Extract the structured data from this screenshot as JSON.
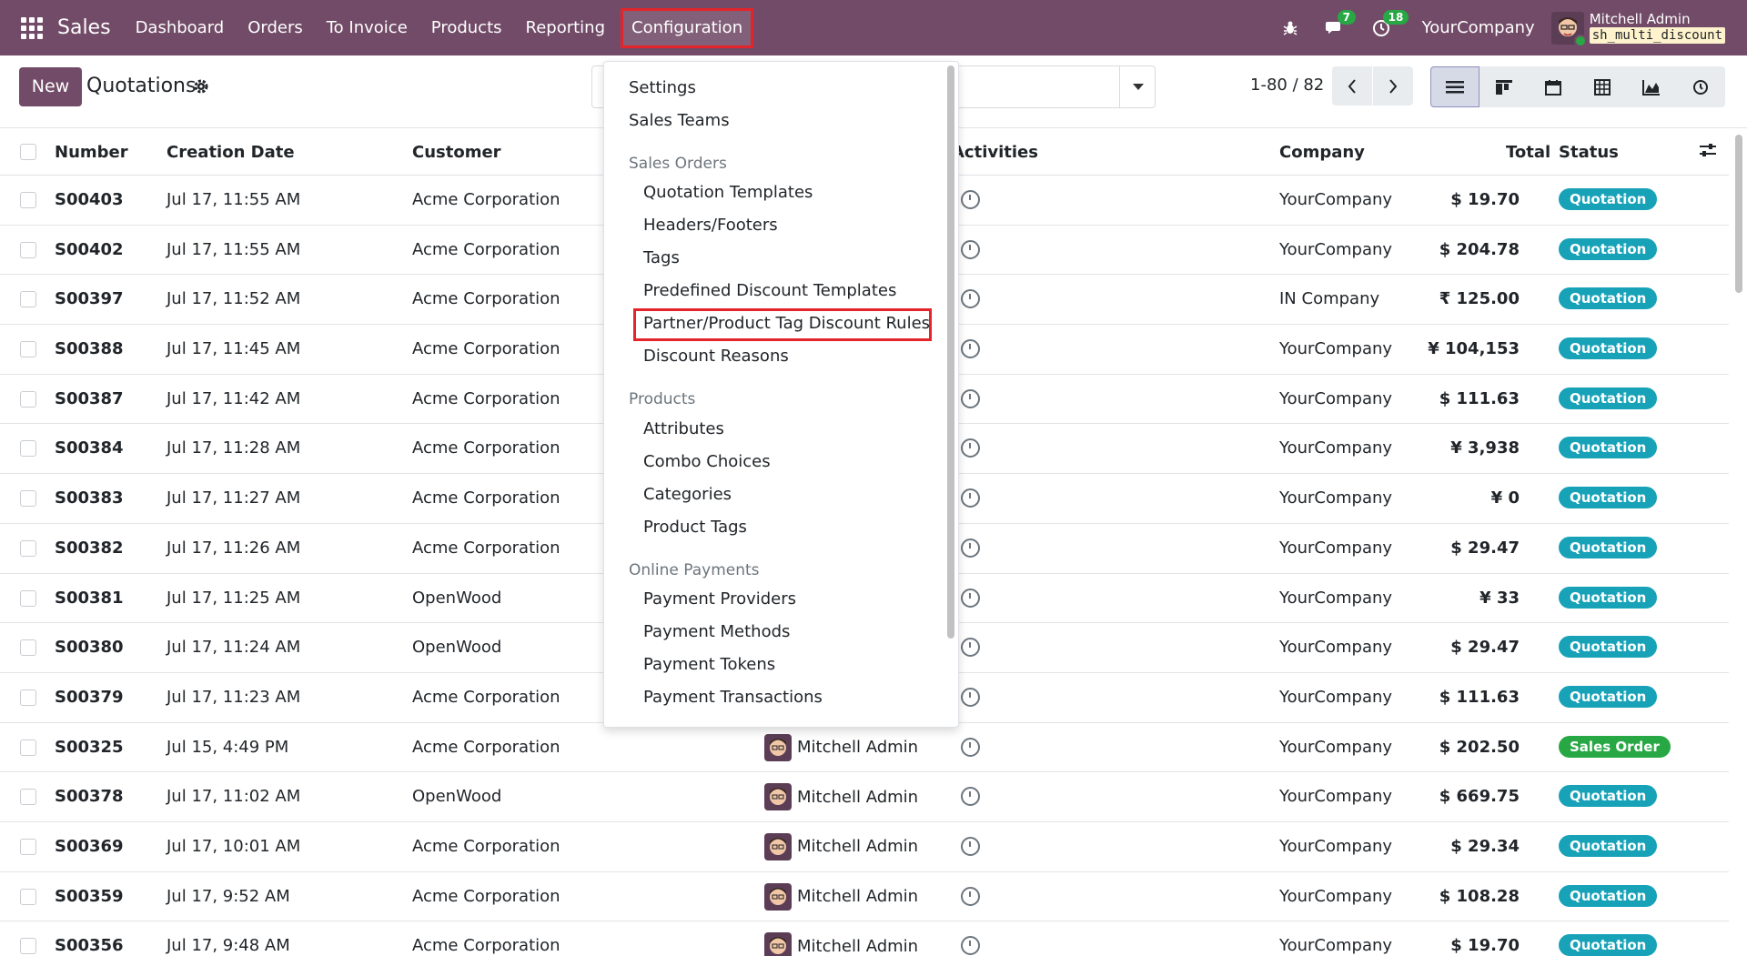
{
  "navbar": {
    "brand": "Sales",
    "menu": [
      "Dashboard",
      "Orders",
      "To Invoice",
      "Products",
      "Reporting",
      "Configuration"
    ],
    "active_menu": "Configuration",
    "messages_count": "7",
    "activities_count": "18",
    "company": "YourCompany",
    "user_name": "Mitchell Admin",
    "database": "sh_multi_discount"
  },
  "control": {
    "new_label": "New",
    "title": "Quotations",
    "pager": "1-80 / 82"
  },
  "table": {
    "headers": {
      "number": "Number",
      "creation_date": "Creation Date",
      "customer": "Customer",
      "activities": "Activities",
      "company": "Company",
      "total": "Total",
      "status": "Status"
    },
    "rows": [
      {
        "number": "S00403",
        "date": "Jul 17, 11:55 AM",
        "customer": "Acme Corporation",
        "salesperson": "",
        "company": "YourCompany",
        "total": "$ 19.70",
        "status": "Quotation"
      },
      {
        "number": "S00402",
        "date": "Jul 17, 11:55 AM",
        "customer": "Acme Corporation",
        "salesperson": "",
        "company": "YourCompany",
        "total": "$ 204.78",
        "status": "Quotation"
      },
      {
        "number": "S00397",
        "date": "Jul 17, 11:52 AM",
        "customer": "Acme Corporation",
        "salesperson": "",
        "company": "IN Company",
        "total": "₹ 125.00",
        "status": "Quotation"
      },
      {
        "number": "S00388",
        "date": "Jul 17, 11:45 AM",
        "customer": "Acme Corporation",
        "salesperson": "",
        "company": "YourCompany",
        "total": "¥ 104,153",
        "status": "Quotation"
      },
      {
        "number": "S00387",
        "date": "Jul 17, 11:42 AM",
        "customer": "Acme Corporation",
        "salesperson": "",
        "company": "YourCompany",
        "total": "$ 111.63",
        "status": "Quotation"
      },
      {
        "number": "S00384",
        "date": "Jul 17, 11:28 AM",
        "customer": "Acme Corporation",
        "salesperson": "",
        "company": "YourCompany",
        "total": "¥ 3,938",
        "status": "Quotation"
      },
      {
        "number": "S00383",
        "date": "Jul 17, 11:27 AM",
        "customer": "Acme Corporation",
        "salesperson": "",
        "company": "YourCompany",
        "total": "¥ 0",
        "status": "Quotation"
      },
      {
        "number": "S00382",
        "date": "Jul 17, 11:26 AM",
        "customer": "Acme Corporation",
        "salesperson": "",
        "company": "YourCompany",
        "total": "$ 29.47",
        "status": "Quotation"
      },
      {
        "number": "S00381",
        "date": "Jul 17, 11:25 AM",
        "customer": "OpenWood",
        "salesperson": "",
        "company": "YourCompany",
        "total": "¥ 33",
        "status": "Quotation"
      },
      {
        "number": "S00380",
        "date": "Jul 17, 11:24 AM",
        "customer": "OpenWood",
        "salesperson": "",
        "company": "YourCompany",
        "total": "$ 29.47",
        "status": "Quotation"
      },
      {
        "number": "S00379",
        "date": "Jul 17, 11:23 AM",
        "customer": "Acme Corporation",
        "salesperson": "",
        "company": "YourCompany",
        "total": "$ 111.63",
        "status": "Quotation"
      },
      {
        "number": "S00325",
        "date": "Jul 15, 4:49 PM",
        "customer": "Acme Corporation",
        "salesperson": "Mitchell Admin",
        "company": "YourCompany",
        "total": "$ 202.50",
        "status": "Sales Order"
      },
      {
        "number": "S00378",
        "date": "Jul 17, 11:02 AM",
        "customer": "OpenWood",
        "salesperson": "Mitchell Admin",
        "company": "YourCompany",
        "total": "$ 669.75",
        "status": "Quotation"
      },
      {
        "number": "S00369",
        "date": "Jul 17, 10:01 AM",
        "customer": "Acme Corporation",
        "salesperson": "Mitchell Admin",
        "company": "YourCompany",
        "total": "$ 29.34",
        "status": "Quotation"
      },
      {
        "number": "S00359",
        "date": "Jul 17, 9:52 AM",
        "customer": "Acme Corporation",
        "salesperson": "Mitchell Admin",
        "company": "YourCompany",
        "total": "$ 108.28",
        "status": "Quotation"
      },
      {
        "number": "S00356",
        "date": "Jul 17, 9:48 AM",
        "customer": "Acme Corporation",
        "salesperson": "Mitchell Admin",
        "company": "YourCompany",
        "total": "$ 19.70",
        "status": "Quotation"
      }
    ]
  },
  "dropdown": {
    "settings": "Settings",
    "sales_teams": "Sales Teams",
    "sales_orders_header": "Sales Orders",
    "quotation_templates": "Quotation Templates",
    "headers_footers": "Headers/Footers",
    "tags": "Tags",
    "predefined_discount_templates": "Predefined Discount Templates",
    "partner_product_tag_discount_rules": "Partner/Product Tag Discount Rules",
    "discount_reasons": "Discount Reasons",
    "products_header": "Products",
    "attributes": "Attributes",
    "combo_choices": "Combo Choices",
    "categories": "Categories",
    "product_tags": "Product Tags",
    "online_payments_header": "Online Payments",
    "payment_providers": "Payment Providers",
    "payment_methods": "Payment Methods",
    "payment_tokens": "Payment Tokens",
    "payment_transactions": "Payment Transactions"
  },
  "colors": {
    "brand": "#714b67",
    "quotation_badge": "#17a2b8",
    "sales_order_badge": "#28a745",
    "highlight": "#e4242b"
  }
}
